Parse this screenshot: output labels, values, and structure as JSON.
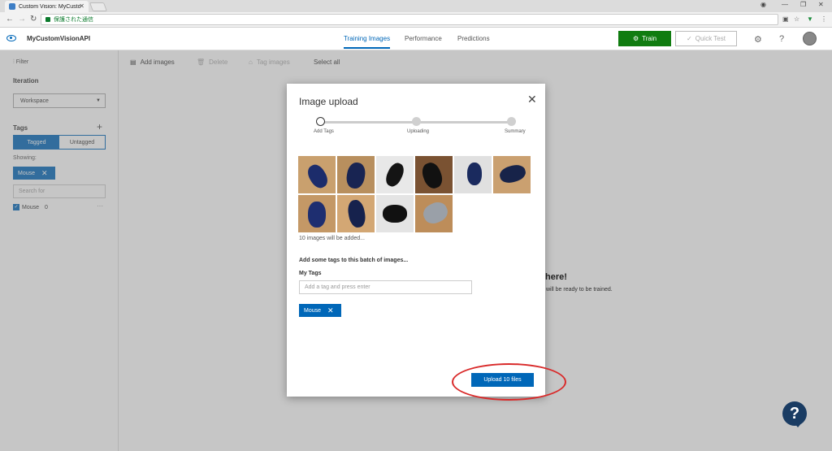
{
  "browser": {
    "tab_title": "Custom Vision: MyCusto",
    "address_text": "保護された通信"
  },
  "app": {
    "project_name": "MyCustomVisionAPI",
    "nav_tabs": [
      "Training Images",
      "Performance",
      "Predictions"
    ],
    "active_tab": "Training Images",
    "train_label": "Train",
    "quick_test_label": "Quick Test"
  },
  "sidebar": {
    "filter_label": "Filter",
    "iteration_heading": "Iteration",
    "iteration_value": "Workspace",
    "tags_heading": "Tags",
    "tagged_label": "Tagged",
    "untagged_label": "Untagged",
    "showing_label": "Showing:",
    "showing_chip": "Mouse",
    "search_placeholder": "Search for",
    "tag_name": "Mouse",
    "tag_count": "0"
  },
  "toolbar": {
    "add_images": "Add images",
    "delete": "Delete",
    "tag_images": "Tag images",
    "select_all": "Select all"
  },
  "background": {
    "headline_fragment": "here!",
    "sub_fragment": "will be ready to be trained."
  },
  "modal": {
    "title": "Image upload",
    "steps": [
      "Add Tags",
      "Uploading",
      "Summary"
    ],
    "image_count_text": "10 images will be added...",
    "batch_prompt": "Add some tags to this batch of images...",
    "my_tags_label": "My Tags",
    "tag_input_placeholder": "Add a tag and press enter",
    "selected_tag": "Mouse",
    "upload_button": "Upload 10 files"
  },
  "colors": {
    "accent": "#0067b8",
    "train_green": "#107c10",
    "highlight_red": "#d92a2a"
  }
}
